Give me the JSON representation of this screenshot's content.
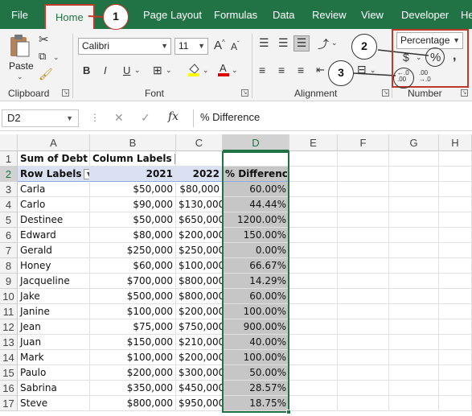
{
  "tabs": [
    "File",
    "Home",
    "Page Layout",
    "Formulas",
    "Data",
    "Review",
    "View",
    "Developer",
    "He"
  ],
  "active_tab": "Home",
  "ribbon": {
    "clipboard": {
      "paste_label": "Paste",
      "group_label": "Clipboard"
    },
    "font": {
      "font_name": "Calibri",
      "font_size": "11",
      "group_label": "Font",
      "bold": "B",
      "italic": "I",
      "underline": "U",
      "grow": "A",
      "shrink": "A"
    },
    "alignment": {
      "group_label": "Alignment"
    },
    "number": {
      "format": "Percentage",
      "currency": "$",
      "percent": "%",
      "comma": ",",
      "inc_decimal": "←.0\n.00",
      "dec_decimal": ".00\n→.0",
      "group_label": "Number"
    }
  },
  "callouts": [
    "1",
    "2",
    "3"
  ],
  "formula_bar": {
    "name_box": "D2",
    "cancel": "✕",
    "enter": "✓",
    "fx": "fx",
    "formula": "% Difference"
  },
  "columns": [
    "A",
    "B",
    "C",
    "D",
    "E",
    "F",
    "G",
    "H"
  ],
  "rows": [
    "1",
    "2",
    "3",
    "4",
    "5",
    "6",
    "7",
    "8",
    "9",
    "10",
    "11",
    "12",
    "13",
    "14",
    "15",
    "16",
    "17"
  ],
  "pivot": {
    "header1": {
      "a": "Sum of Debt",
      "b": "Column Labels"
    },
    "header2": {
      "a": "Row Labels",
      "b": "2021",
      "c": "2022",
      "d": "% Difference"
    },
    "data": [
      {
        "name": "Carla",
        "y2021": "$50,000",
        "y2022": "$80,000",
        "diff": "60.00%"
      },
      {
        "name": "Carlo",
        "y2021": "$90,000",
        "y2022": "$130,000",
        "diff": "44.44%"
      },
      {
        "name": "Destinee",
        "y2021": "$50,000",
        "y2022": "$650,000",
        "diff": "1200.00%"
      },
      {
        "name": "Edward",
        "y2021": "$80,000",
        "y2022": "$200,000",
        "diff": "150.00%"
      },
      {
        "name": "Gerald",
        "y2021": "$250,000",
        "y2022": "$250,000",
        "diff": "0.00%"
      },
      {
        "name": "Honey",
        "y2021": "$60,000",
        "y2022": "$100,000",
        "diff": "66.67%"
      },
      {
        "name": "Jacqueline",
        "y2021": "$700,000",
        "y2022": "$800,000",
        "diff": "14.29%"
      },
      {
        "name": "Jake",
        "y2021": "$500,000",
        "y2022": "$800,000",
        "diff": "60.00%"
      },
      {
        "name": "Janine",
        "y2021": "$100,000",
        "y2022": "$200,000",
        "diff": "100.00%"
      },
      {
        "name": "Jean",
        "y2021": "$75,000",
        "y2022": "$750,000",
        "diff": "900.00%"
      },
      {
        "name": "Juan",
        "y2021": "$150,000",
        "y2022": "$210,000",
        "diff": "40.00%"
      },
      {
        "name": "Mark",
        "y2021": "$100,000",
        "y2022": "$200,000",
        "diff": "100.00%"
      },
      {
        "name": "Paulo",
        "y2021": "$200,000",
        "y2022": "$300,000",
        "diff": "50.00%"
      },
      {
        "name": "Sabrina",
        "y2021": "$350,000",
        "y2022": "$450,000",
        "diff": "28.57%"
      },
      {
        "name": "Steve",
        "y2021": "$800,000",
        "y2022": "$950,000",
        "diff": "18.75%"
      }
    ]
  },
  "colors": {
    "excel_green": "#217346",
    "callout_red": "#c0392b",
    "pivot_header": "#d9e1f2",
    "selection": "#c6c6c6"
  }
}
